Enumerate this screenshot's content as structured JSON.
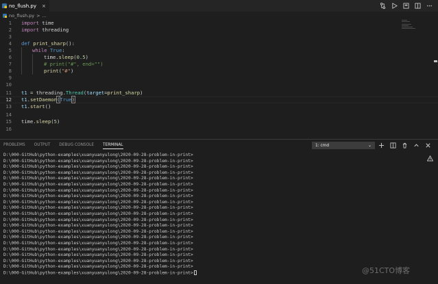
{
  "tab": {
    "label": "no_flush.py",
    "close": "×"
  },
  "breadcrumb": {
    "file": "no_flush.py",
    "separator": ">",
    "rest": "..."
  },
  "editor": {
    "line_numbers": [
      "1",
      "2",
      "3",
      "4",
      "5",
      "6",
      "7",
      "8",
      "9",
      "10",
      "11",
      "12",
      "13",
      "14",
      "15",
      "16"
    ],
    "code": {
      "l1a": "import",
      "l1b": " time",
      "l2a": "import",
      "l2b": " threading",
      "l4a": "def",
      "l4b": " print_sharp",
      "l4c": "():",
      "l5a": "while",
      "l5b": " True",
      "l5c": ":",
      "l6a": "time",
      "l6b": ".",
      "l6c": "sleep",
      "l6d": "(",
      "l6e": "0.5",
      "l6f": ")",
      "l7": "# print(\"#\", end=\"\")",
      "l8a": "print",
      "l8b": "(",
      "l8c": "\"#\"",
      "l8d": ")",
      "l11a": "t1",
      "l11b": " = ",
      "l11c": "threading",
      "l11d": ".",
      "l11e": "Thread",
      "l11f": "(",
      "l11g": "target",
      "l11h": "=",
      "l11i": "print_sharp",
      "l11j": ")",
      "l12a": "t1",
      "l12b": ".",
      "l12c": "setDaemon",
      "l12d": "(",
      "l12e": "True",
      "l12f": ")",
      "l13a": "t1",
      "l13b": ".",
      "l13c": "start",
      "l13d": "()",
      "l15a": "time",
      "l15b": ".",
      "l15c": "sleep",
      "l15d": "(",
      "l15e": "5",
      "l15f": ")"
    }
  },
  "panel": {
    "tabs": [
      "PROBLEMS",
      "OUTPUT",
      "DEBUG CONSOLE",
      "TERMINAL"
    ],
    "active_tab": "TERMINAL",
    "terminal_select": "1: cmd",
    "chevron": "⌄"
  },
  "terminal": {
    "prompt": "D:\\000-GitHub\\python-examples\\xuanyuanyulong\\2020-09-28-problem-in-print>",
    "line_count": 21
  },
  "watermark": "@51CTO博客",
  "colors": {
    "accent": "#007acc",
    "background": "#1e1e1e",
    "keyword": "#c586c0",
    "string": "#ce9178"
  }
}
